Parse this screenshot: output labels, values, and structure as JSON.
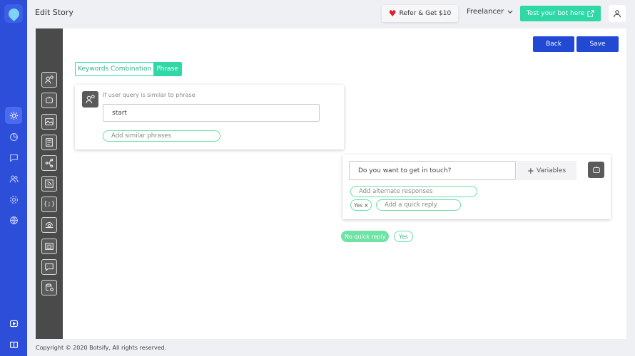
{
  "header": {
    "title": "Edit Story",
    "refer_label": "Refer & Get $10",
    "plan_label": "Freelancer",
    "test_bot_label": "Test your bot here",
    "user_icon": "user-icon"
  },
  "sidebar": {
    "icons": [
      "logo-icon",
      "bot-builder-icon",
      "analytics-icon",
      "chat-icon",
      "users-icon",
      "settings-icon",
      "globe-icon",
      "video-icon",
      "book-icon"
    ],
    "active": "bot-builder-icon"
  },
  "canvas": {
    "back_label": "Back",
    "save_label": "Save",
    "tabs": [
      "Keywords Combination",
      "Phrase"
    ],
    "active_tab": "Phrase",
    "toolbox_icons": [
      "user-query-icon",
      "bot-reply-icon",
      "image-icon",
      "document-icon",
      "branch-icon",
      "rss-icon",
      "code-icon",
      "api-icon",
      "card-icon",
      "chat-icon",
      "database-icon"
    ]
  },
  "user_card": {
    "label": "If user query is similar to phrase",
    "phrase_value": "start",
    "similar_placeholder": "Add similar phrases"
  },
  "bot_card": {
    "response_value": "Do you want to get in touch?",
    "variables_label": "Variables",
    "alternate_placeholder": "Add alternate responses",
    "chip_label": "Yes",
    "chip_close": "×",
    "quick_reply_placeholder": "Add a quick reply"
  },
  "quick_replies": [
    "No quick reply",
    "Yes"
  ],
  "footer": {
    "copyright": "Copyright © 2020 Botsify, All rights reserved."
  },
  "colors": {
    "primary": "#2149d4",
    "accent": "#2fd8a6",
    "sidebar": "#2d4ed8",
    "toolbox": "#4a4a4a"
  }
}
